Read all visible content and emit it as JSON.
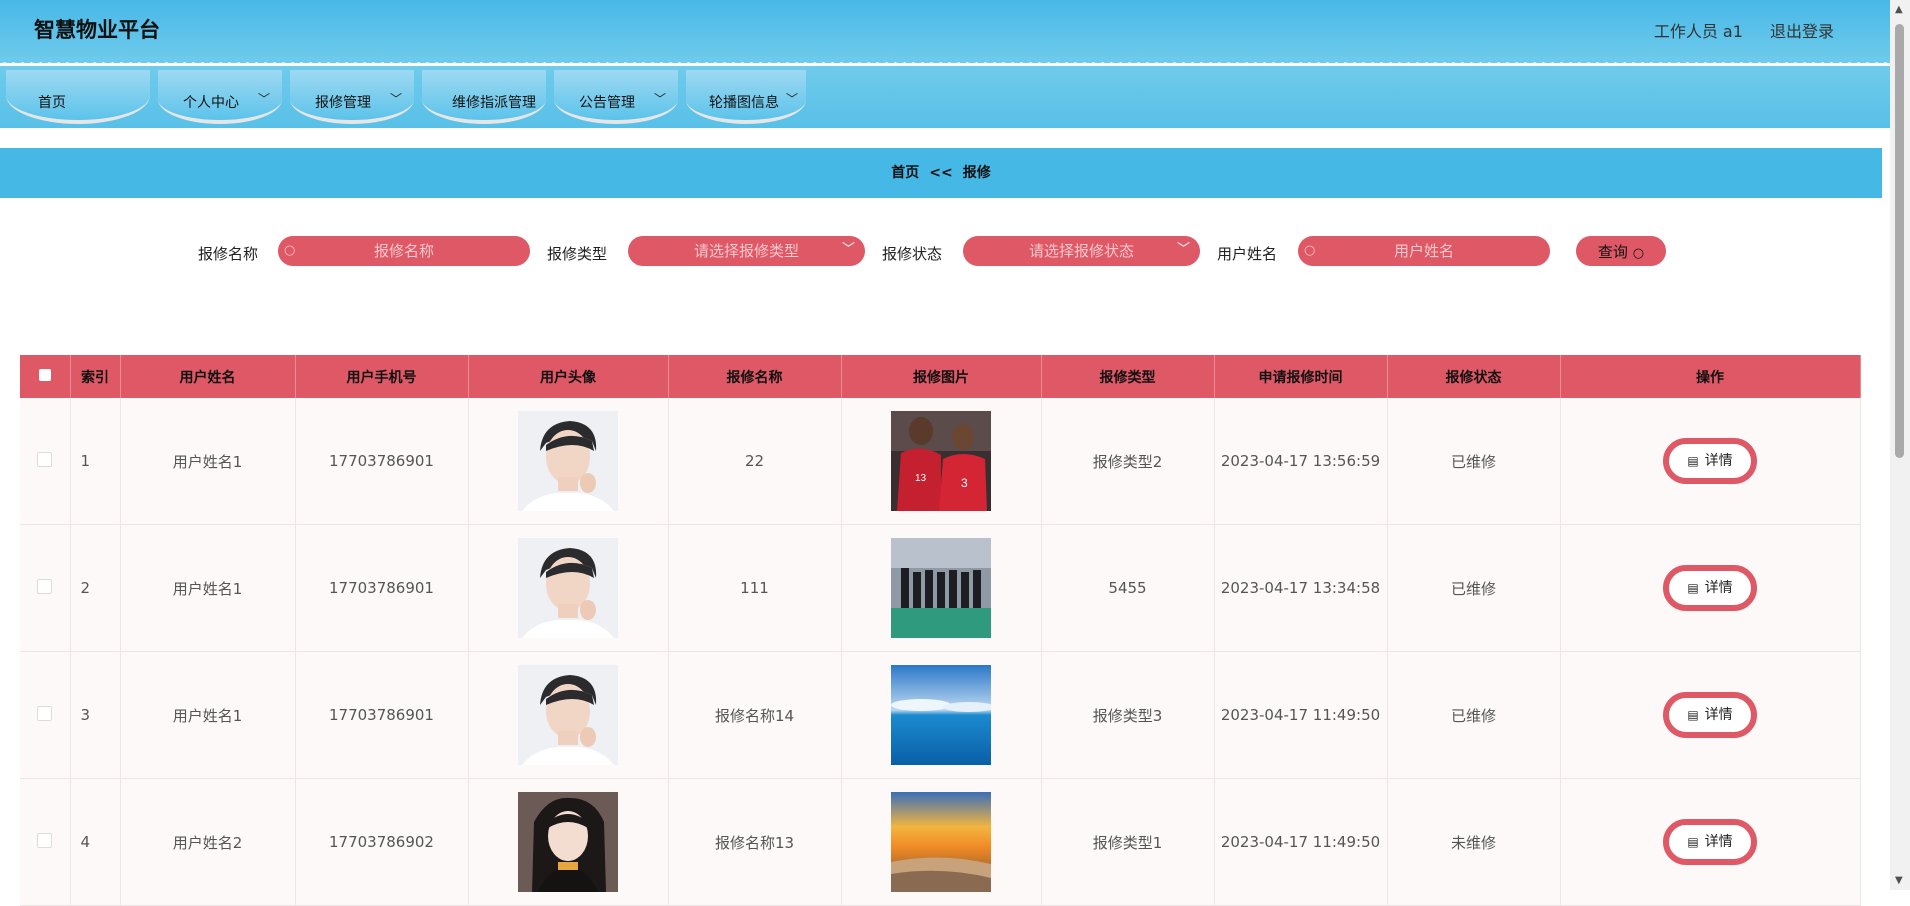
{
  "app": {
    "title": "智慧物业平台"
  },
  "header": {
    "user": "工作人员 a1",
    "logout": "退出登录"
  },
  "nav": {
    "home": "首页",
    "personal": "个人中心",
    "repair": "报修管理",
    "dispatch": "维修指派管理",
    "notice": "公告管理",
    "carousel": "轮播图信息"
  },
  "breadcrumb": {
    "home": "首页",
    "sep": "<<",
    "current": "报修"
  },
  "search": {
    "name_label": "报修名称",
    "name_placeholder": "报修名称",
    "type_label": "报修类型",
    "type_placeholder": "请选择报修类型",
    "status_label": "报修状态",
    "status_placeholder": "请选择报修状态",
    "user_label": "用户姓名",
    "user_placeholder": "用户姓名",
    "query": "查询"
  },
  "table": {
    "columns": [
      "索引",
      "用户姓名",
      "用户手机号",
      "用户头像",
      "报修名称",
      "报修图片",
      "报修类型",
      "申请报修时间",
      "报修状态",
      "操作"
    ],
    "detail_label": "详情",
    "rows": [
      {
        "index": "1",
        "user": "用户姓名1",
        "phone": "17703786901",
        "name": "22",
        "type": "报修类型2",
        "time": "2023-04-17 13:56:59",
        "status": "已维修"
      },
      {
        "index": "2",
        "user": "用户姓名1",
        "phone": "17703786901",
        "name": "111",
        "type": "5455",
        "time": "2023-04-17 13:34:58",
        "status": "已维修"
      },
      {
        "index": "3",
        "user": "用户姓名1",
        "phone": "17703786901",
        "name": "报修名称14",
        "type": "报修类型3",
        "time": "2023-04-17 11:49:50",
        "status": "已维修"
      },
      {
        "index": "4",
        "user": "用户姓名2",
        "phone": "17703786902",
        "name": "报修名称13",
        "type": "报修类型1",
        "time": "2023-04-17 11:49:50",
        "status": "未维修"
      }
    ]
  },
  "colors": {
    "accent": "#df5866",
    "header_blue": "#45b8e6"
  },
  "icons": {
    "search": "search-icon",
    "chevron": "chevron-down-icon",
    "detail": "document-icon"
  }
}
